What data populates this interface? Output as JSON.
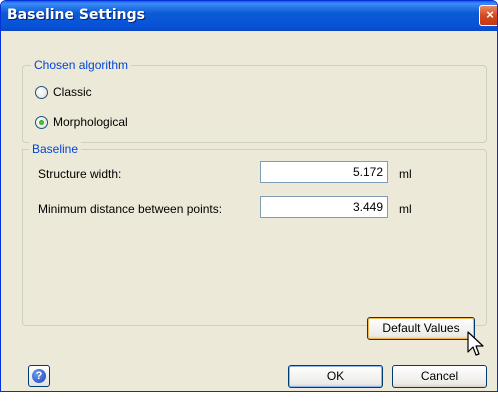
{
  "window": {
    "title": "Baseline Settings",
    "close_symbol": "×"
  },
  "algorithm": {
    "group_label": "Chosen algorithm",
    "options": [
      {
        "label": "Classic",
        "checked": false
      },
      {
        "label": "Morphological",
        "checked": true
      }
    ]
  },
  "baseline": {
    "group_label": "Baseline",
    "fields": [
      {
        "label": "Structure width:",
        "value": "5.172",
        "unit": "ml"
      },
      {
        "label": "Minimum distance between points:",
        "value": "3.449",
        "unit": "ml"
      }
    ],
    "default_values_label": "Default Values"
  },
  "footer": {
    "help_symbol": "?",
    "ok_label": "OK",
    "cancel_label": "Cancel"
  },
  "icons": {
    "help": "help-icon",
    "close": "close-icon",
    "cursor": "mouse-pointer-icon"
  }
}
